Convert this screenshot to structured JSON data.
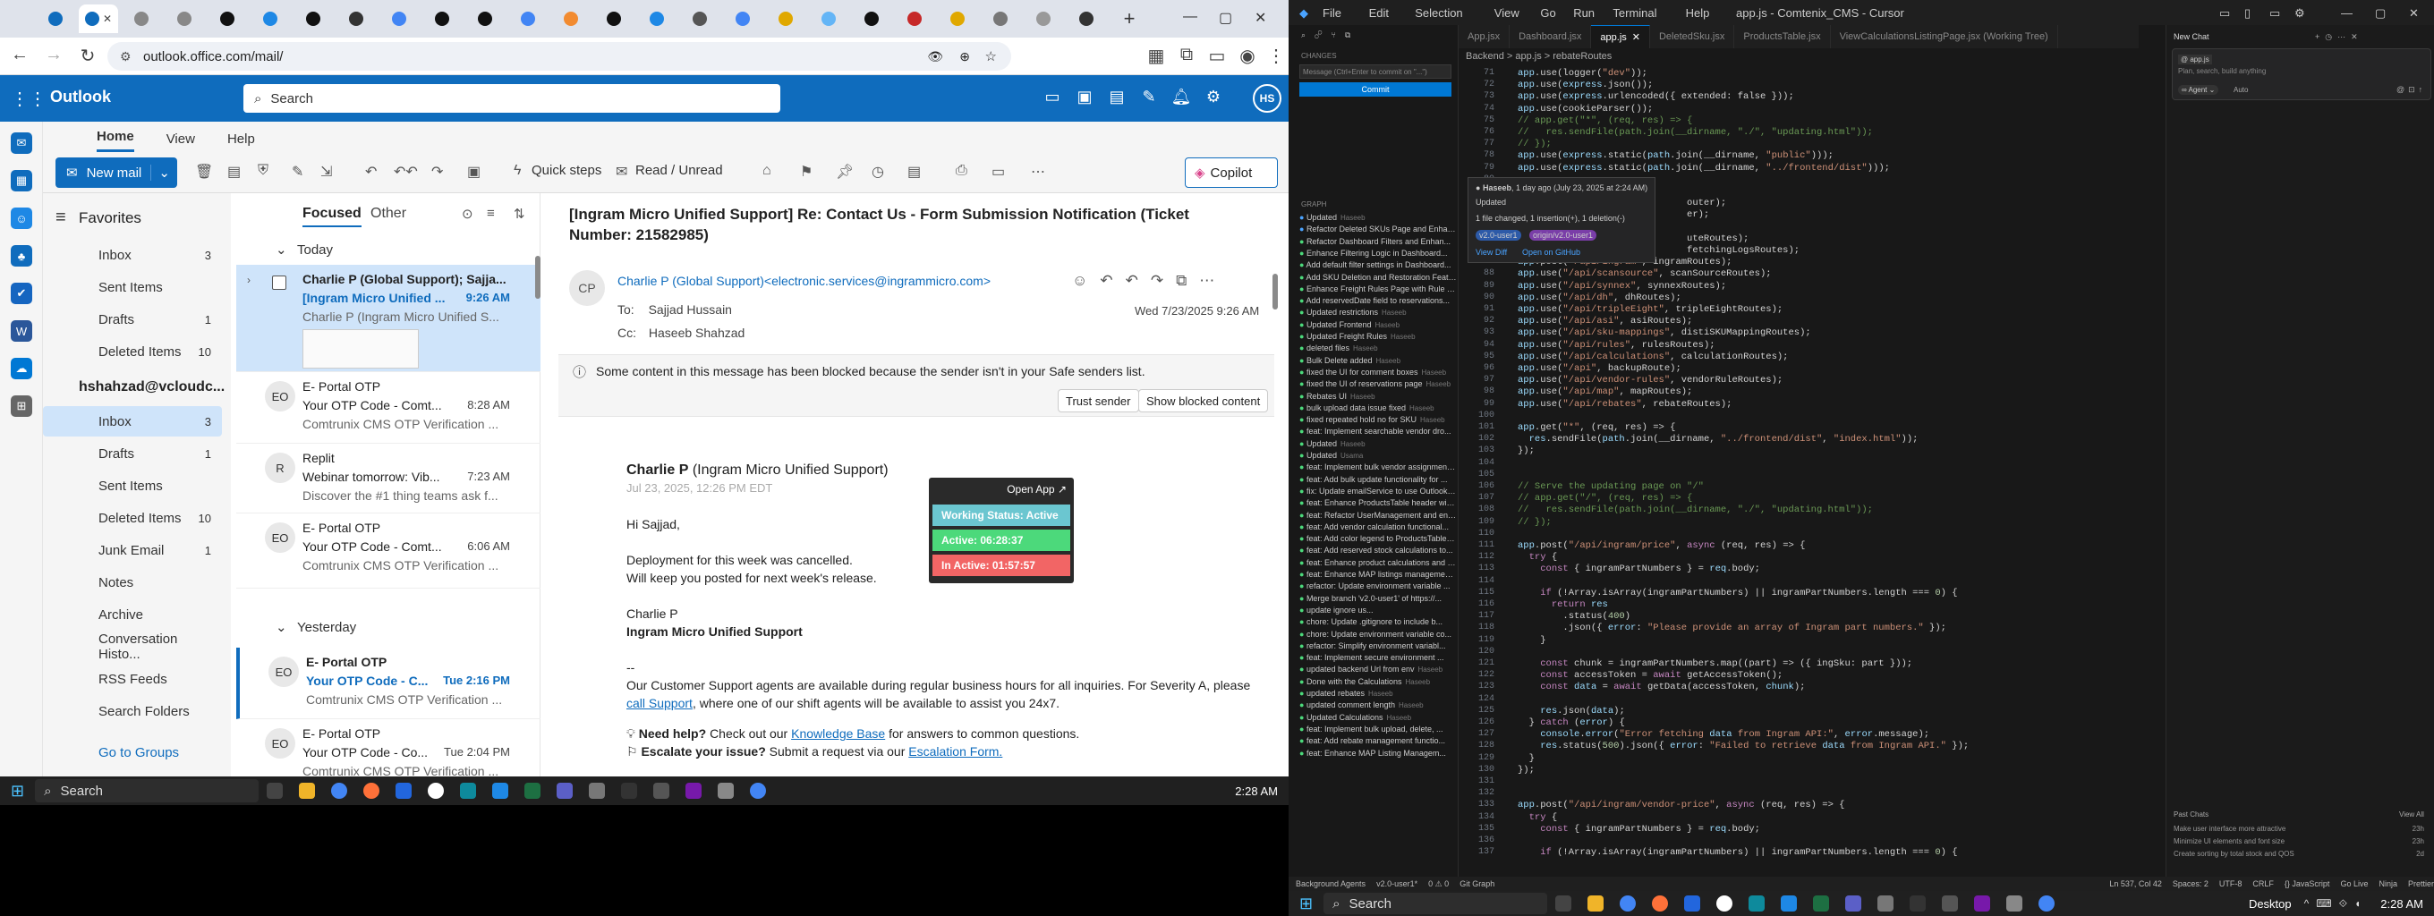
{
  "browser": {
    "url": "outlook.office.com/mail/"
  },
  "outlook": {
    "app_name": "Outlook",
    "search_placeholder": "Search",
    "avatar_initials": "HS",
    "ribbon_tabs": [
      "Home",
      "View",
      "Help"
    ],
    "new_mail": "New mail",
    "quick_steps": "Quick steps",
    "read_unread": "Read / Unread",
    "copilot": "Copilot",
    "favorites_label": "Favorites",
    "favorites": [
      {
        "label": "Inbox",
        "count": "3"
      },
      {
        "label": "Sent Items",
        "count": ""
      },
      {
        "label": "Drafts",
        "count": "1"
      },
      {
        "label": "Deleted Items",
        "count": "10"
      }
    ],
    "account_label": "hshahzad@vcloudc...",
    "folders": [
      {
        "label": "Inbox",
        "count": "3"
      },
      {
        "label": "Drafts",
        "count": "1"
      },
      {
        "label": "Sent Items",
        "count": ""
      },
      {
        "label": "Deleted Items",
        "count": "10"
      },
      {
        "label": "Junk Email",
        "count": "1"
      },
      {
        "label": "Notes",
        "count": ""
      },
      {
        "label": "Archive",
        "count": ""
      },
      {
        "label": "Conversation Histo...",
        "count": ""
      },
      {
        "label": "RSS Feeds",
        "count": ""
      },
      {
        "label": "Search Folders",
        "count": ""
      }
    ],
    "go_to_groups": "Go to Groups",
    "list_tabs": {
      "focused": "Focused",
      "other": "Other"
    },
    "group_today": "Today",
    "group_yesterday": "Yesterday",
    "messages": [
      {
        "initials": "",
        "from": "Charlie P (Global Support); Sajja...",
        "subject": "[Ingram Micro Unified ...",
        "time": "9:26 AM",
        "preview": "Charlie P (Ingram Micro Unified S..."
      },
      {
        "initials": "EO",
        "from": "E- Portal OTP",
        "subject": "Your OTP Code - Comt...",
        "time": "8:28 AM",
        "preview": "Comtrunix CMS OTP Verification ..."
      },
      {
        "initials": "R",
        "from": "Replit",
        "subject": "Webinar tomorrow: Vib...",
        "time": "7:23 AM",
        "preview": "Discover the #1 thing teams ask f..."
      },
      {
        "initials": "EO",
        "from": "E- Portal OTP",
        "subject": "Your OTP Code - Comt...",
        "time": "6:06 AM",
        "preview": "Comtrunix CMS OTP Verification ..."
      },
      {
        "initials": "EO",
        "from": "E- Portal OTP",
        "subject": "Your OTP Code - C...",
        "time": "Tue 2:16 PM",
        "preview": "Comtrunix CMS OTP Verification ..."
      },
      {
        "initials": "EO",
        "from": "E- Portal OTP",
        "subject": "Your OTP Code - Co...",
        "time": "Tue 2:04 PM",
        "preview": "Comtrunix CMS OTP Verification ..."
      }
    ],
    "reading": {
      "subject": "[Ingram Micro Unified Support] Re: Contact Us - Form Submission Notification (Ticket Number: 21582985)",
      "sender_initials": "CP",
      "sender": "Charlie P (Global Support)<electronic.services@ingrammicro.com>",
      "to_label": "To:",
      "to": "Sajjad Hussain",
      "cc_label": "Cc:",
      "cc": "Haseeb Shahzad",
      "date": "Wed 7/23/2025 9:26 AM",
      "blocked_msg": "Some content in this message has been blocked because the sender isn't in your Safe senders list.",
      "trust_btn": "Trust sender",
      "show_blocked_btn": "Show blocked content",
      "body_sender": "Charlie P",
      "body_sender_org": "(Ingram Micro Unified Support)",
      "body_date": "Jul 23, 2025, 12:26 PM EDT",
      "greeting": "Hi Sajjad,",
      "line1": "Deployment for this week was cancelled.",
      "line2": "Will keep you posted for next week's release.",
      "sig_name": "Charlie P",
      "sig_org": "Ingram Micro Unified Support",
      "sep": "--",
      "support_text_1": "Our Customer Support agents are available during regular business hours for all inquiries. For Severity A, please",
      "call_support": "call Support",
      "support_text_2": ", where one of our shift agents will be available to assist you 24x7.",
      "need_help": "Need help?",
      "need_help_text": "Check out our",
      "kb": "Knowledge Base",
      "need_help_tail": "for answers to common questions.",
      "escalate": "Escalate your issue?",
      "escalate_text": "Submit a request via our",
      "escalation_form": "Escalation Form."
    },
    "widget": {
      "open_app": "Open App",
      "working": "Working Status: Active",
      "active": "Active: 06:28:37",
      "inactive": "In Active: 01:57:57"
    }
  },
  "taskbar_left": {
    "search": "Search",
    "clock": "2:28 AM"
  },
  "cursor": {
    "menus": [
      "File",
      "Edit",
      "Selection",
      "View",
      "Go",
      "Run",
      "Terminal",
      "Help"
    ],
    "title": "app.js - Comtenix_CMS - Cursor",
    "tabs": [
      "App.jsx",
      "Dashboard.jsx",
      "app.js",
      "DeletedSku.jsx",
      "ProductsTable.jsx",
      "ViewCalculationsListingPage.jsx (Working Tree)"
    ],
    "breadcrumb": "Backend > app.js > rebateRoutes",
    "scm_header": "CHANGES",
    "commit_placeholder": "Message (Ctrl+Enter to commit on \"...\")",
    "commit_btn": "Commit",
    "graph_label": "GRAPH",
    "commits": [
      {
        "msg": "Updated",
        "author": "Haseeb"
      },
      {
        "msg": "Refactor Deleted SKUs Page and Enhan...",
        "author": ""
      },
      {
        "msg": "Refactor Dashboard Filters and Enhan...",
        "author": ""
      },
      {
        "msg": "Enhance Filtering Logic in Dashboard...",
        "author": ""
      },
      {
        "msg": "Add default filter settings in Dashboard...",
        "author": ""
      },
      {
        "msg": "Add SKU Deletion and Restoration Feat...",
        "author": ""
      },
      {
        "msg": "Enhance Freight Rules Page with Rule T...",
        "author": ""
      },
      {
        "msg": "Add reservedDate field to reservations...",
        "author": ""
      },
      {
        "msg": "Updated restrictions",
        "author": "Haseeb"
      },
      {
        "msg": "Updated Frontend",
        "author": "Haseeb"
      },
      {
        "msg": "Updated Freight Rules",
        "author": "Haseeb"
      },
      {
        "msg": "deleted files",
        "author": "Haseeb"
      },
      {
        "msg": "Bulk Delete added",
        "author": "Haseeb"
      },
      {
        "msg": "fixed the UI for comment boxes",
        "author": "Haseeb"
      },
      {
        "msg": "fixed the UI of reservations page",
        "author": "Haseeb"
      },
      {
        "msg": "Rebates UI",
        "author": "Haseeb"
      },
      {
        "msg": "bulk upload data issue fixed",
        "author": "Haseeb"
      },
      {
        "msg": "fixed repeated hold no for SKU",
        "author": "Haseeb"
      },
      {
        "msg": "feat: Implement searchable vendor dro...",
        "author": ""
      },
      {
        "msg": "Updated",
        "author": "Haseeb"
      },
      {
        "msg": "Updated",
        "author": "Usama"
      },
      {
        "msg": "feat: Implement bulk vendor assignmen...",
        "author": ""
      },
      {
        "msg": "feat: Add bulk update functionality for ...",
        "author": ""
      },
      {
        "msg": "fix: Update emailService to use Outlook...",
        "author": ""
      },
      {
        "msg": "feat: Enhance ProductsTable header wit...",
        "author": ""
      },
      {
        "msg": "feat: Refactor UserManagement and en...",
        "author": ""
      },
      {
        "msg": "feat: Add vendor calculation functional...",
        "author": ""
      },
      {
        "msg": "feat: Add color legend to ProductsTable...",
        "author": ""
      },
      {
        "msg": "feat: Add reserved stock calculations to...",
        "author": ""
      },
      {
        "msg": "feat: Enhance product calculations and ...",
        "author": ""
      },
      {
        "msg": "feat: Enhance MAP listings managemen...",
        "author": ""
      },
      {
        "msg": "refactor: Update environment variable ...",
        "author": ""
      },
      {
        "msg": "Merge branch 'v2.0-user1' of https://...",
        "author": ""
      },
      {
        "msg": "update ignore us...",
        "author": ""
      },
      {
        "msg": "chore: Update .gitignore to include b...",
        "author": ""
      },
      {
        "msg": "chore: Update environment variable co...",
        "author": ""
      },
      {
        "msg": "refactor: Simplify environment variabl...",
        "author": ""
      },
      {
        "msg": "feat: Implement secure environment ...",
        "author": ""
      },
      {
        "msg": "updated backend Url from env",
        "author": "Haseeb"
      },
      {
        "msg": "Done with the Calculations",
        "author": "Haseeb"
      },
      {
        "msg": "updated rebates",
        "author": "Haseeb"
      },
      {
        "msg": "updated comment length",
        "author": "Haseeb"
      },
      {
        "msg": "Updated Calculations",
        "author": "Haseeb"
      },
      {
        "msg": "feat: Implement bulk upload, delete, ...",
        "author": ""
      },
      {
        "msg": "feat: Add rebate management functio...",
        "author": ""
      },
      {
        "msg": "feat: Enhance MAP Listing Managem...",
        "author": ""
      }
    ],
    "hover": {
      "author": "Haseeb",
      "when": "1 day ago (July 23, 2025 at 2:24 AM)",
      "msg": "Updated",
      "stats": "1 file changed, 1 insertion(+), 1 deletion(-)",
      "branch": "v2.0-user1",
      "remote": "origin/v2.0-user1",
      "view": "View Diff",
      "open": "Open on GitHub"
    },
    "chat": {
      "title": "New Chat",
      "mention": "@ app.js",
      "placeholder": "Plan, search, build anything",
      "agent": "Agent",
      "auto": "Auto",
      "past_chats": "Past Chats",
      "view_all": "View All",
      "chats": [
        {
          "title": "Make user interface more attractive",
          "age": "23h"
        },
        {
          "title": "Minimize UI elements and font size",
          "age": "23h"
        },
        {
          "title": "Create sorting by total stock and QOS",
          "age": "2d"
        }
      ]
    },
    "status": [
      "Background Agents",
      "v2.0-user1*",
      "0 ⚠ 0",
      "Git Graph",
      "Ln 537, Col 42",
      "Spaces: 2",
      "UTF-8",
      "CRLF",
      "{} JavaScript",
      "Go Live",
      "Ninja",
      "Prettier"
    ],
    "lines": [
      {
        "n": "71",
        "c": "app.use(logger(\"dev\"));"
      },
      {
        "n": "72",
        "c": "app.use(express.json());"
      },
      {
        "n": "73",
        "c": "app.use(express.urlencoded({ extended: false }));"
      },
      {
        "n": "74",
        "c": "app.use(cookieParser());"
      },
      {
        "n": "75",
        "c": "// app.get(\"*\", (req, res) => {"
      },
      {
        "n": "76",
        "c": "//   res.sendFile(path.join(__dirname, \"./\", \"updating.html\"));"
      },
      {
        "n": "77",
        "c": "// });"
      },
      {
        "n": "78",
        "c": "app.use(express.static(path.join(__dirname, \"public\")));"
      },
      {
        "n": "79",
        "c": "app.use(express.static(path.join(__dirname, \"../frontend/dist\")));"
      },
      {
        "n": "80",
        "c": ""
      },
      {
        "n": "81",
        "c": ""
      },
      {
        "n": "82",
        "c": "                              outer);"
      },
      {
        "n": "83",
        "c": "                              er);"
      },
      {
        "n": "84",
        "c": ""
      },
      {
        "n": "85",
        "c": "                              uteRoutes);"
      },
      {
        "n": "86",
        "c": "                              fetchingLogsRoutes);"
      },
      {
        "n": "87",
        "c": "app.post(\"/api/ingram\", ingramRoutes);"
      },
      {
        "n": "88",
        "c": "app.use(\"/api/scansource\", scanSourceRoutes);"
      },
      {
        "n": "89",
        "c": "app.use(\"/api/synnex\", synnexRoutes);"
      },
      {
        "n": "90",
        "c": "app.use(\"/api/dh\", dhRoutes);"
      },
      {
        "n": "91",
        "c": "app.use(\"/api/tripleEight\", tripleEightRoutes);"
      },
      {
        "n": "92",
        "c": "app.use(\"/api/asi\", asiRoutes);"
      },
      {
        "n": "93",
        "c": "app.use(\"/api/sku-mappings\", distiSKUMappingRoutes);"
      },
      {
        "n": "94",
        "c": "app.use(\"/api/rules\", rulesRoutes);"
      },
      {
        "n": "95",
        "c": "app.use(\"/api/calculations\", calculationRoutes);"
      },
      {
        "n": "96",
        "c": "app.use(\"/api\", backupRoute);"
      },
      {
        "n": "97",
        "c": "app.use(\"/api/vendor-rules\", vendorRuleRoutes);"
      },
      {
        "n": "98",
        "c": "app.use(\"/api/map\", mapRoutes);"
      },
      {
        "n": "99",
        "c": "app.use(\"/api/rebates\", rebateRoutes);"
      },
      {
        "n": "100",
        "c": ""
      },
      {
        "n": "101",
        "c": "app.get(\"*\", (req, res) => {"
      },
      {
        "n": "102",
        "c": "  res.sendFile(path.join(__dirname, \"../frontend/dist\", \"index.html\"));"
      },
      {
        "n": "103",
        "c": "});"
      },
      {
        "n": "104",
        "c": ""
      },
      {
        "n": "105",
        "c": ""
      },
      {
        "n": "106",
        "c": "// Serve the updating page on \"/\""
      },
      {
        "n": "107",
        "c": "// app.get(\"/\", (req, res) => {"
      },
      {
        "n": "108",
        "c": "//   res.sendFile(path.join(__dirname, \"./\", \"updating.html\"));"
      },
      {
        "n": "109",
        "c": "// });"
      },
      {
        "n": "110",
        "c": ""
      },
      {
        "n": "111",
        "c": "app.post(\"/api/ingram/price\", async (req, res) => {"
      },
      {
        "n": "112",
        "c": "  try {"
      },
      {
        "n": "113",
        "c": "    const { ingramPartNumbers } = req.body;"
      },
      {
        "n": "114",
        "c": ""
      },
      {
        "n": "115",
        "c": "    if (!Array.isArray(ingramPartNumbers) || ingramPartNumbers.length === 0) {"
      },
      {
        "n": "116",
        "c": "      return res"
      },
      {
        "n": "117",
        "c": "        .status(400)"
      },
      {
        "n": "118",
        "c": "        .json({ error: \"Please provide an array of Ingram part numbers.\" });"
      },
      {
        "n": "119",
        "c": "    }"
      },
      {
        "n": "120",
        "c": ""
      },
      {
        "n": "121",
        "c": "    const chunk = ingramPartNumbers.map((part) => ({ ingSku: part }));"
      },
      {
        "n": "122",
        "c": "    const accessToken = await getAccessToken();"
      },
      {
        "n": "123",
        "c": "    const data = await getData(accessToken, chunk);"
      },
      {
        "n": "124",
        "c": ""
      },
      {
        "n": "125",
        "c": "    res.json(data);"
      },
      {
        "n": "126",
        "c": "  } catch (error) {"
      },
      {
        "n": "127",
        "c": "    console.error(\"Error fetching data from Ingram API:\", error.message);"
      },
      {
        "n": "128",
        "c": "    res.status(500).json({ error: \"Failed to retrieve data from Ingram API.\" });"
      },
      {
        "n": "129",
        "c": "  }"
      },
      {
        "n": "130",
        "c": "});"
      },
      {
        "n": "131",
        "c": ""
      },
      {
        "n": "132",
        "c": ""
      },
      {
        "n": "133",
        "c": "app.post(\"/api/ingram/vendor-price\", async (req, res) => {"
      },
      {
        "n": "134",
        "c": "  try {"
      },
      {
        "n": "135",
        "c": "    const { ingramPartNumbers } = req.body;"
      },
      {
        "n": "136",
        "c": ""
      },
      {
        "n": "137",
        "c": "    if (!Array.isArray(ingramPartNumbers) || ingramPartNumbers.length === 0) {"
      }
    ]
  },
  "taskbar_right": {
    "search": "Search",
    "desktop": "Desktop",
    "clock": "2:28 AM"
  },
  "colors": {
    "outlook_blue": "#0f6cbd",
    "widget_green": "#4cd97b",
    "widget_red": "#f26565",
    "widget_teal": "#6bc6d0"
  }
}
